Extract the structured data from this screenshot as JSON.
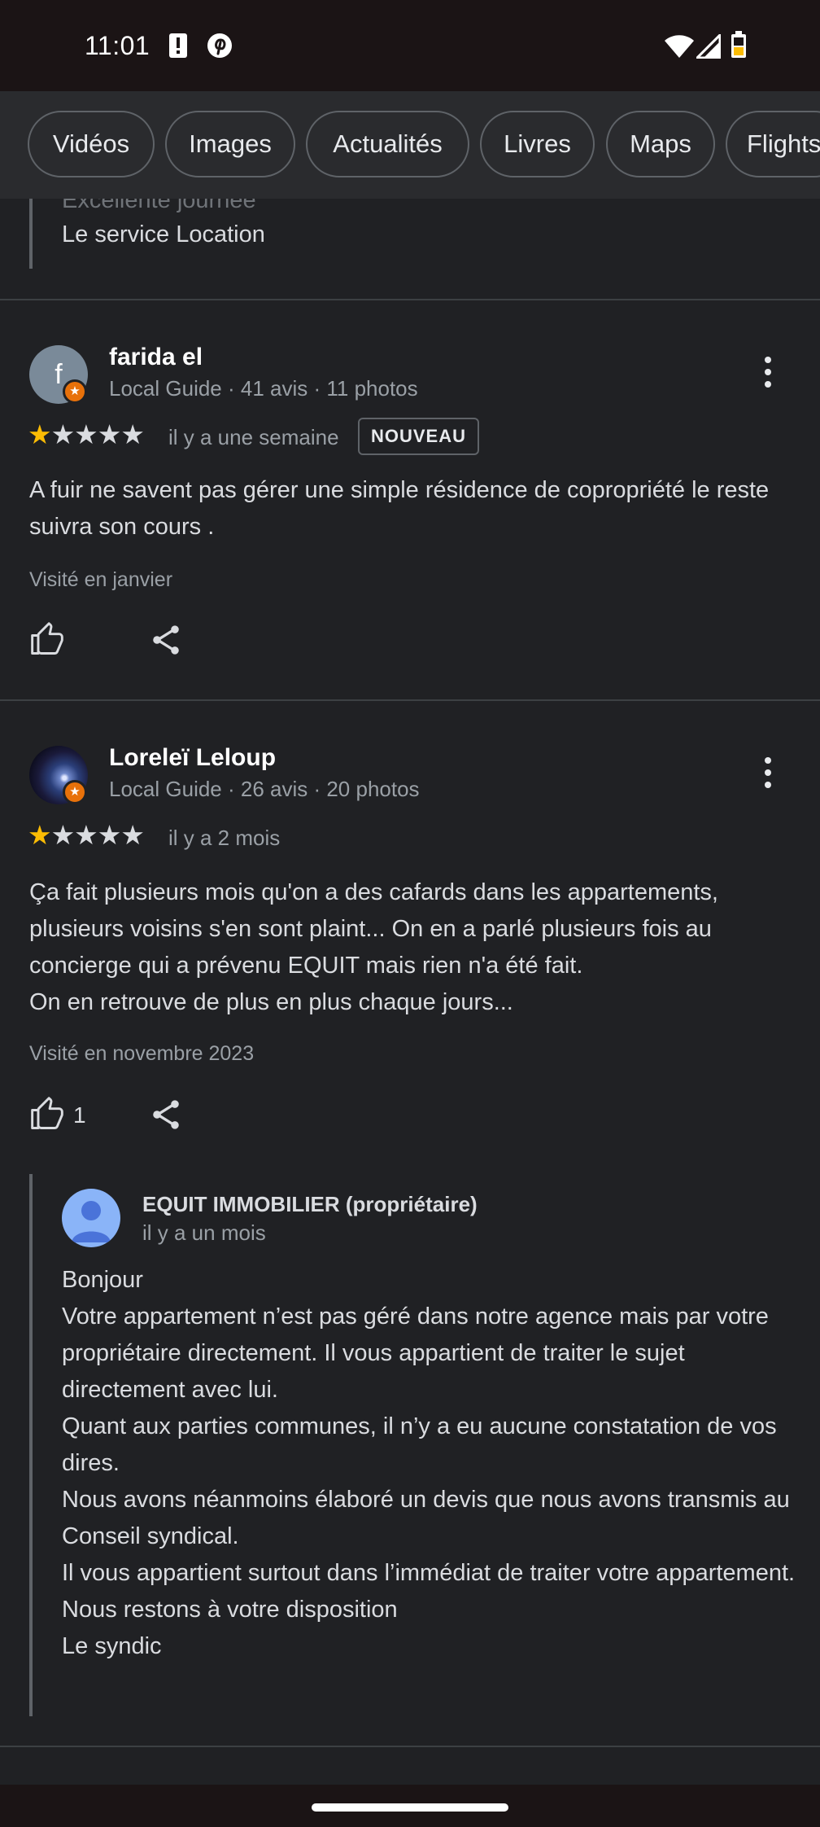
{
  "status_bar": {
    "time": "11:01",
    "left_icons": [
      "alert-icon",
      "pinterest-icon"
    ],
    "right_icons": [
      "wifi-icon",
      "signal-icon",
      "battery-icon"
    ]
  },
  "chips": [
    "Vidéos",
    "Images",
    "Actualités",
    "Livres",
    "Maps",
    "Flights"
  ],
  "previous_review": {
    "faded_line": "Excellente journée",
    "line": "Le service Location"
  },
  "reviews": [
    {
      "avatar_letter": "f",
      "name": "farida el",
      "meta": "Local Guide · 41 avis · 11 photos",
      "rating": 1,
      "time": "il y a une semaine",
      "badge": "NOUVEAU",
      "text": "A fuir ne savent pas gérer une simple résidence de copropriété le reste suivra son cours .",
      "visited": "Visité en janvier",
      "likes": ""
    },
    {
      "name": "Loreleï Leloup",
      "meta": "Local Guide · 26 avis · 20 photos",
      "rating": 1,
      "time": "il y a 2 mois",
      "text_lines": [
        "Ça fait plusieurs mois qu'on a des cafards dans les appartements, plusieurs voisins s'en sont plaint... On en a parlé plusieurs fois au concierge qui a prévenu EQUIT mais rien n'a été fait.",
        "On en retrouve de plus en plus chaque jours..."
      ],
      "visited": "Visité en novembre 2023",
      "likes": "1",
      "owner_reply": {
        "name": "EQUIT IMMOBILIER (propriétaire)",
        "time": "il y a un mois",
        "lines": [
          "Bonjour",
          "Votre appartement n’est pas géré dans notre agence mais par votre propriétaire directement. Il vous appartient de traiter le sujet directement avec lui.",
          "Quant aux parties communes, il n’y a eu aucune constatation de vos dires.",
          "Nous avons néanmoins élaboré un devis que nous avons transmis au Conseil syndical.",
          "Il vous appartient surtout dans l’immédiat de traiter votre appartement.",
          "Nous restons à votre disposition",
          "Le syndic"
        ]
      }
    }
  ],
  "colors": {
    "background": "#202124",
    "status_bar": "#1b1415",
    "chip_bar": "#2a2b2e",
    "star": "#fbbc04",
    "guide_badge": "#e8710a",
    "owner_avatar": "#8ab4f8"
  }
}
